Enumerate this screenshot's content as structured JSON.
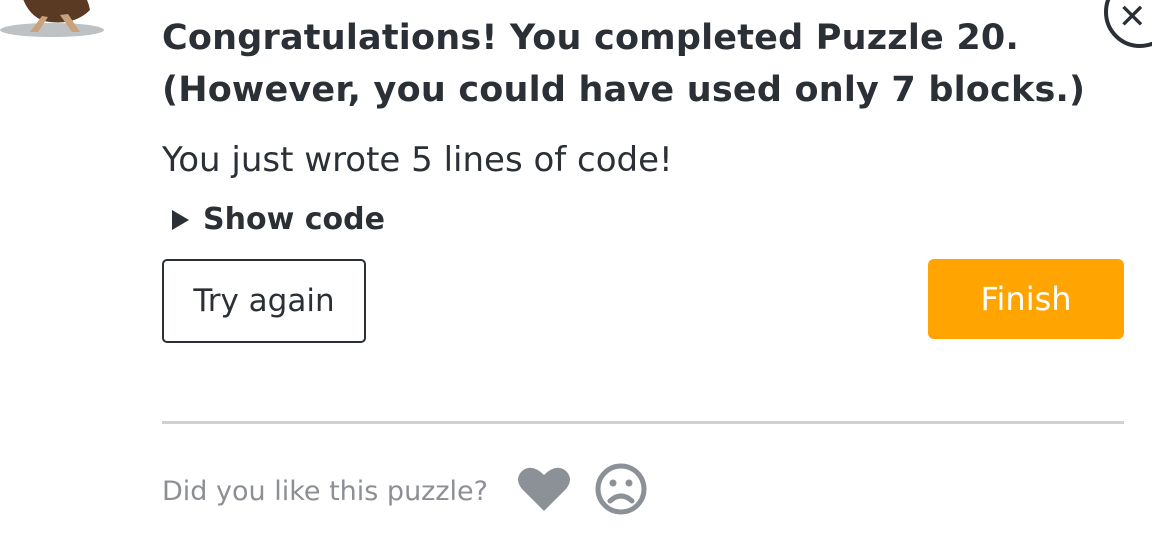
{
  "dialog": {
    "title_line1": "Congratulations! You completed Puzzle 20.",
    "title_line2": "(However, you could have used only 7 blocks.)",
    "lines_message": "You just wrote 5 lines of code!",
    "show_code_label": "Show code",
    "try_again_label": "Try again",
    "finish_label": "Finish"
  },
  "feedback": {
    "question": "Did you like this puzzle?",
    "icons": [
      "heart-icon",
      "sad-face-icon"
    ]
  },
  "colors": {
    "text": "#2b2f36",
    "finish_button": "#ffa400",
    "muted": "#8c8f94",
    "divider": "#cfd1d3"
  }
}
